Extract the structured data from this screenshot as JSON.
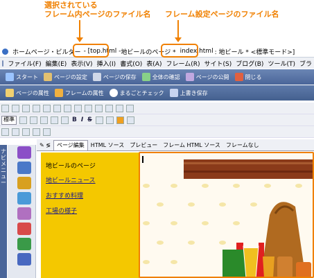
{
  "annotations": {
    "left_label_line1": "選択されている",
    "left_label_line2": "フレーム内ページのファイル名",
    "right_label": "フレーム設定ページのファイル名"
  },
  "titlebar": {
    "app": "ホームページ・ビルダー",
    "frame_file": "- [top.html - ",
    "frame_title": "地ビールのページ *",
    "frameset_file": "index.html",
    "rest": ": 地ビール * <標準モード>]"
  },
  "menu": [
    "ファイル(F)",
    "編集(E)",
    "表示(V)",
    "挿入(I)",
    "書式(O)",
    "表(A)",
    "フレーム(R)",
    "サイト(S)",
    "ブログ(B)",
    "ツール(T)",
    "ブラ"
  ],
  "toolbar1": [
    "スタート",
    "ページの設定",
    "ページの保存",
    "全体の確認",
    "ページの公開",
    "閉じる"
  ],
  "toolbar2": [
    "ページの属性",
    "フレームの属性",
    "まるごとチェック",
    "上書き保存"
  ],
  "format": {
    "style_select": "標準",
    "bold": "B",
    "italic": "I",
    "strike": "S"
  },
  "left_nav_label": "ナビメニュー",
  "tabs": [
    "ページ編集",
    "HTML ソース",
    "プレビュー",
    "フレーム HTML ソース",
    "フレームなし"
  ],
  "left_frame": {
    "title": "地ビールのページ",
    "links": [
      "地ビールニュース",
      "おすすめ料理",
      "工場の様子"
    ]
  },
  "colors": {
    "accent": "#f08000",
    "left_frame_bg": "#f4c800",
    "toolbar_blue": "#4a6599"
  }
}
